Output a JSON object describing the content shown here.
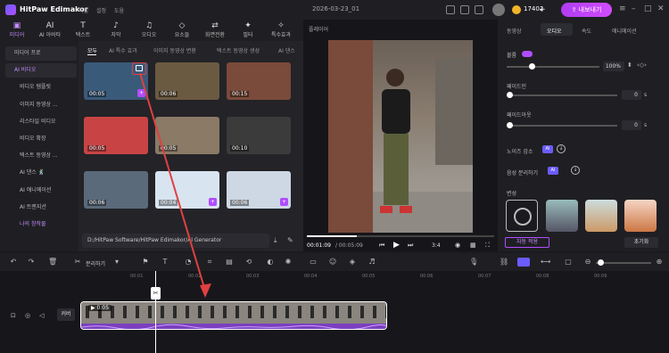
{
  "app": {
    "name": "HitPaw Edimakor",
    "menus": [
      "파일",
      "설정",
      "도움"
    ],
    "project": "2026-03-23_01",
    "credits": "17402",
    "upgrade": "내보내기",
    "add": "+"
  },
  "toolbar": {
    "items": [
      {
        "icon": "▣",
        "label": "미디어"
      },
      {
        "icon": "AI",
        "label": "AI 아바타"
      },
      {
        "icon": "T",
        "label": "텍스트"
      },
      {
        "icon": "♪",
        "label": "자막"
      },
      {
        "icon": "♫",
        "label": "오디오"
      },
      {
        "icon": "◇",
        "label": "요소들"
      },
      {
        "icon": "⇄",
        "label": "화면전환"
      },
      {
        "icon": "✦",
        "label": "필터"
      },
      {
        "icon": "✧",
        "label": "특수효과"
      }
    ]
  },
  "sidebar": {
    "items": [
      {
        "label": "미디어 프로",
        "head": true
      },
      {
        "label": "AI 비디오",
        "head": true,
        "active": true
      },
      {
        "label": "비디오 템플릿"
      },
      {
        "label": "이미지 동영상 ..."
      },
      {
        "label": "리스타일 비디오"
      },
      {
        "label": "비디오 확장"
      },
      {
        "label": "텍스트 동영상 ..."
      },
      {
        "label": "AI 댄스 🕺"
      },
      {
        "label": "AI 애니메이션"
      },
      {
        "label": "AI 트랜지션"
      },
      {
        "label": "나의 창작물",
        "active": true
      }
    ]
  },
  "media": {
    "tabs": [
      "모두",
      "AI 특수 효과",
      "이미지 동영상 변환",
      "텍스트 동영상 생성",
      "AI 댄스"
    ],
    "thumbs": [
      {
        "dur": "00:05",
        "ai": "+"
      },
      {
        "dur": "00:06",
        "ai": ""
      },
      {
        "dur": "00:15",
        "ai": ""
      },
      {
        "dur": "00:05",
        "ai": ""
      },
      {
        "dur": "00:05",
        "ai": ""
      },
      {
        "dur": "00:10",
        "ai": ""
      },
      {
        "dur": "00:06",
        "ai": ""
      },
      {
        "dur": "00:04",
        "ai": "+"
      },
      {
        "dur": "00:06",
        "ai": "+"
      }
    ],
    "path": "D:/HitPaw Software/HitPaw Edimakor/AI Generator"
  },
  "player": {
    "title": "플레이어",
    "current": "00:01:09",
    "total": "/ 00:05:09",
    "ratio": "3:4"
  },
  "props": {
    "tabs": [
      "동영상",
      "오디오",
      "속도",
      "애니메이션"
    ],
    "volume_label": "볼륨",
    "volume_value": "100%",
    "fadein_label": "페이드인",
    "fadein_value": "0",
    "fadeout_label": "페이드아웃",
    "fadeout_value": "0",
    "unit": "s",
    "noise_label": "노이즈 감소",
    "separate_label": "음성 분리하기",
    "voice_label": "변성",
    "reset_label": "초기화",
    "apply_label": "자동 적용"
  },
  "timeline": {
    "ticks": [
      "00:01",
      "00:02",
      "00:03",
      "00:04",
      "00:05",
      "00:06",
      "00:07",
      "00:08",
      "00:09"
    ],
    "split_label": "분리하기",
    "clip_time": "0:05",
    "cover_label": "커버"
  }
}
